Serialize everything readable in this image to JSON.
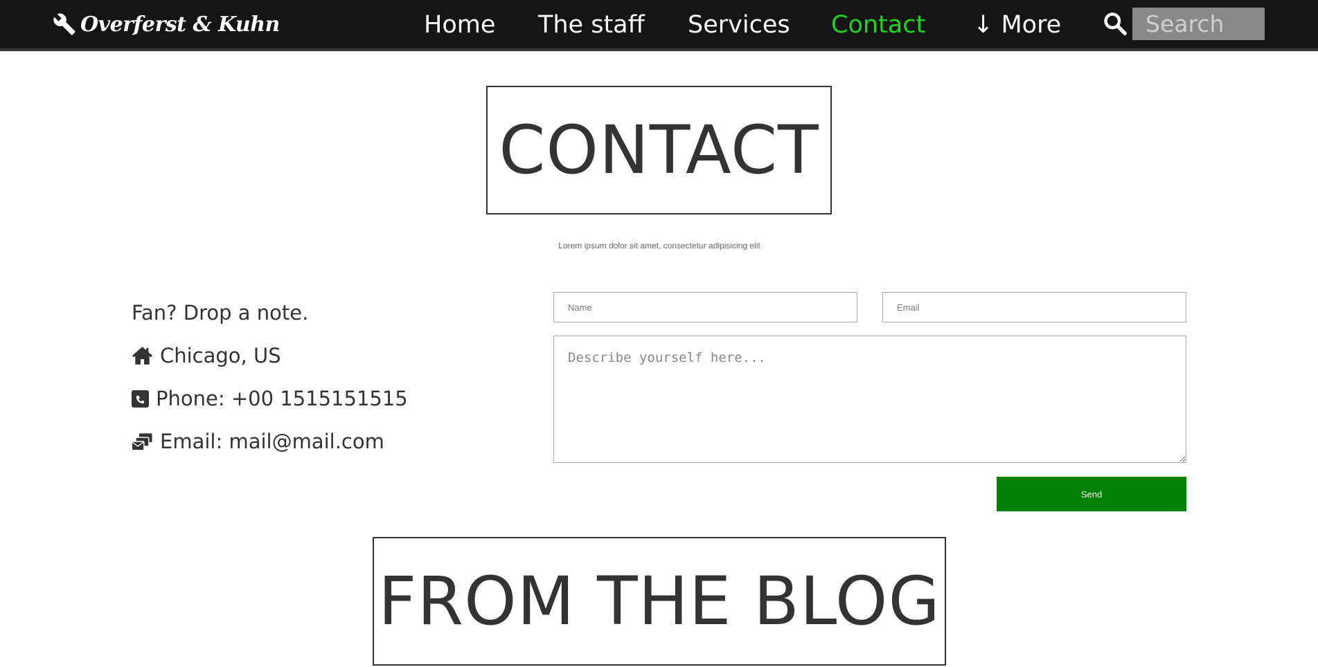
{
  "brand": {
    "name": "Overferst & Kuhn",
    "icon": "wrench-icon"
  },
  "nav": {
    "items": [
      {
        "label": "Home",
        "active": false
      },
      {
        "label": "The staff",
        "active": false
      },
      {
        "label": "Services",
        "active": false
      },
      {
        "label": "Contact",
        "active": true
      },
      {
        "label": "↓ More",
        "active": false
      }
    ],
    "search": {
      "placeholder": "Search",
      "icon": "search-icon"
    }
  },
  "contact": {
    "title": "CONTACT",
    "subtitle": "Lorem ipsum dolor sit amet, consectetur adipisicing elit",
    "info": {
      "tagline": "Fan? Drop a note.",
      "location": "Chicago, US",
      "phone": "Phone: +00 1515151515",
      "email": "Email: mail@mail.com"
    },
    "form": {
      "name_placeholder": "Name",
      "email_placeholder": "Email",
      "message_placeholder": "Describe yourself here...",
      "send_label": "Send"
    }
  },
  "blog": {
    "title": "FROM THE BLOG"
  },
  "colors": {
    "nav_background": "#151515",
    "nav_active": "#1ed31e",
    "send_button": "#008000",
    "search_background": "#888888",
    "text": "#333333"
  }
}
